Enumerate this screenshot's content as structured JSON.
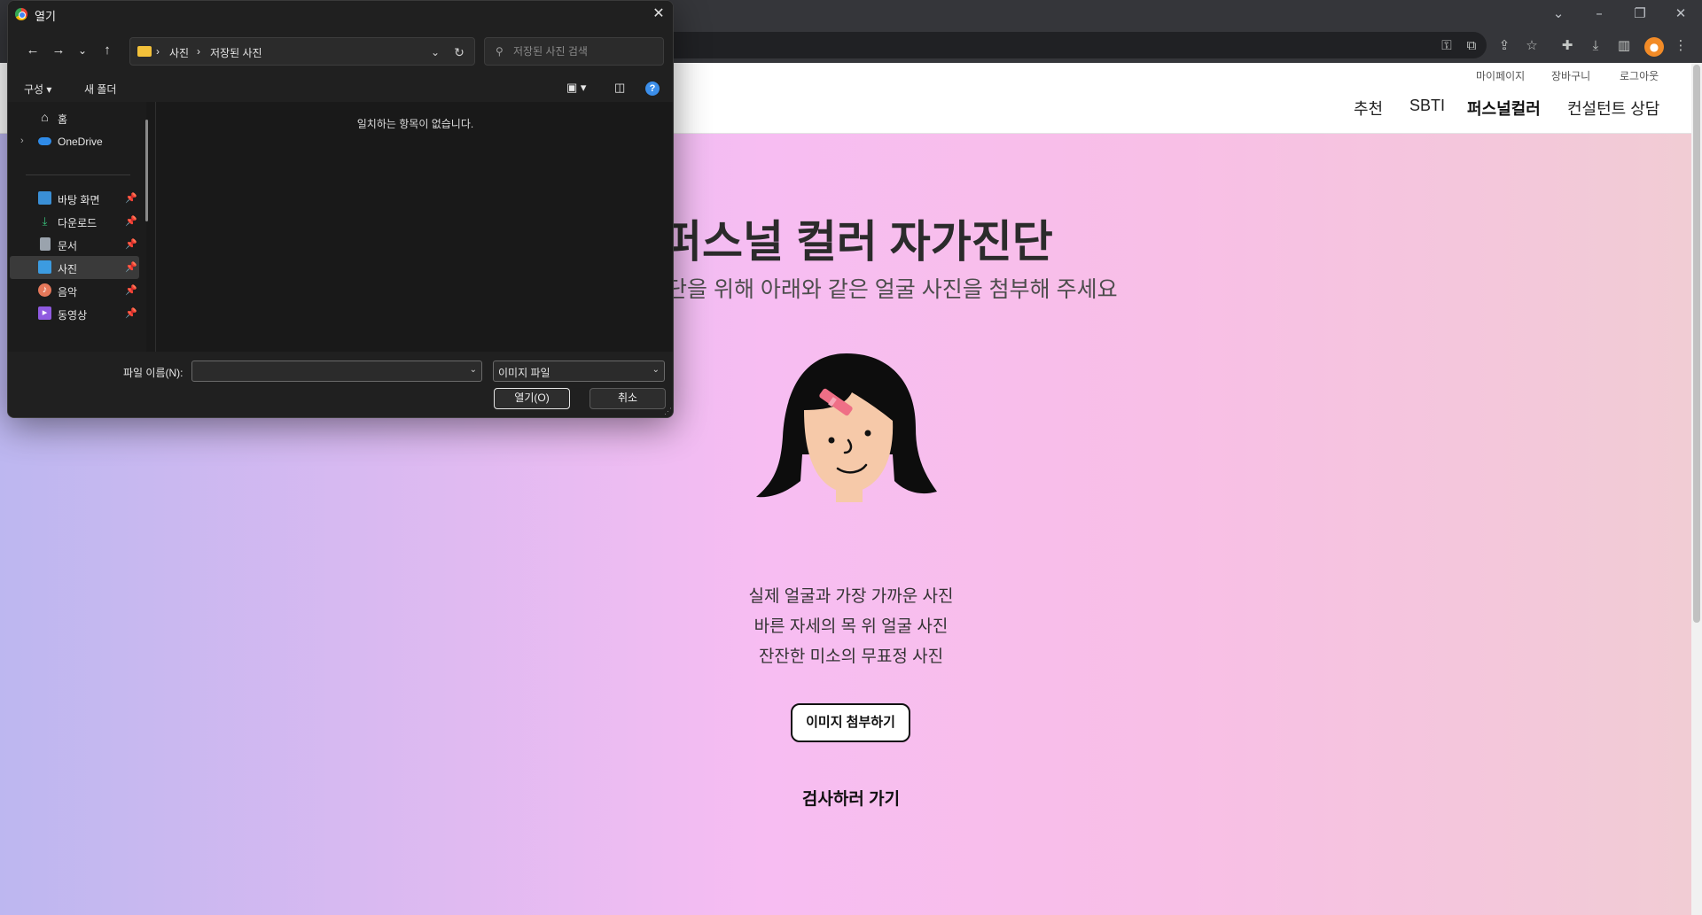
{
  "dialog": {
    "title": "열기",
    "breadcrumb": [
      "사진",
      "저장된 사진"
    ],
    "search_placeholder": "저장된 사진 검색",
    "organize_label": "구성 ▾",
    "new_folder_label": "새 폴더",
    "empty_message": "일치하는 항목이 없습니다.",
    "nav_items": [
      {
        "label": "홈",
        "icon": "home-icon"
      },
      {
        "label": "OneDrive",
        "icon": "cloud-icon"
      },
      {
        "label": "바탕 화면",
        "icon": "desktop-icon",
        "pinned": true
      },
      {
        "label": "다운로드",
        "icon": "download-icon",
        "pinned": true
      },
      {
        "label": "문서",
        "icon": "document-icon",
        "pinned": true
      },
      {
        "label": "사진",
        "icon": "picture-icon",
        "pinned": true,
        "selected": true
      },
      {
        "label": "음악",
        "icon": "music-icon",
        "pinned": true
      },
      {
        "label": "동영상",
        "icon": "video-icon",
        "pinned": true
      }
    ],
    "filename_label": "파일 이름(N):",
    "filename_value": "",
    "filetype_value": "이미지 파일",
    "open_button": "열기(O)",
    "cancel_button": "취소"
  },
  "site": {
    "util_links": [
      "마이페이지",
      "장바구니",
      "로그아웃"
    ],
    "nav": [
      "추천",
      "SBTI",
      "퍼스널컬러",
      "컨설턴트 상담"
    ],
    "active_nav": "퍼스널컬러",
    "title": "퍼스널 컬러 자가진단",
    "subtitle": "단을 위해 아래와 같은 얼굴 사진을 첨부해 주세요",
    "guides": [
      "실제 얼굴과 가장 가까운 사진",
      "바른 자세의 목 위 얼굴 사진",
      "잔잔한 미소의 무표정 사진"
    ],
    "attach_button": "이미지 첨부하기",
    "go_test": "검사하러 가기"
  },
  "colors": {
    "gradient": [
      "#bdb7f0",
      "#f7bdf2",
      "#f1ccd4"
    ],
    "dialog_bg": "#1c1c1c",
    "accent": "#3b8eea"
  }
}
